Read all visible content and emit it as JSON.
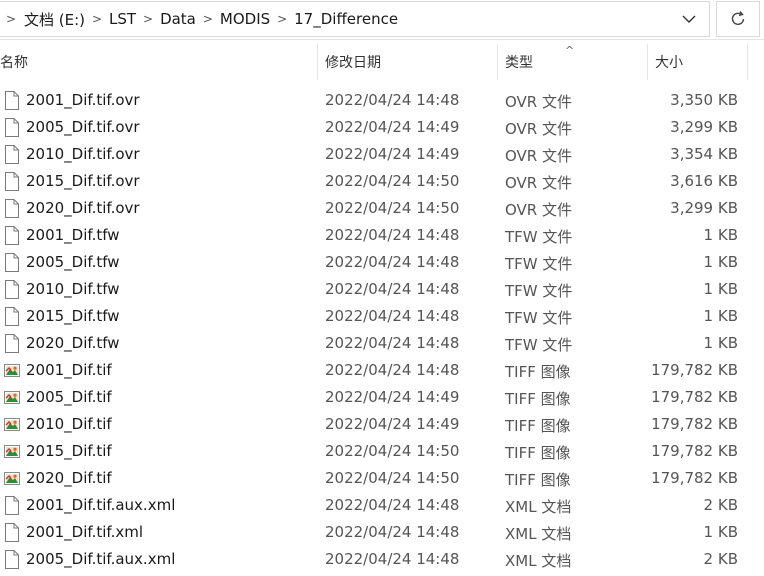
{
  "breadcrumb": [
    "文档 (E:)",
    "LST",
    "Data",
    "MODIS",
    "17_Difference"
  ],
  "icons": {
    "dropdown": "chevron-down-icon",
    "refresh": "refresh-icon",
    "generic_file": "file-icon",
    "tiff_file": "image-file-icon"
  },
  "columns": {
    "name": "名称",
    "date": "修改日期",
    "type": "类型",
    "size": "大小"
  },
  "files": [
    {
      "name": "2001_Dif.tif.ovr",
      "date": "2022/04/24 14:48",
      "type": "OVR 文件",
      "size": "3,350 KB",
      "icon": "file"
    },
    {
      "name": "2005_Dif.tif.ovr",
      "date": "2022/04/24 14:49",
      "type": "OVR 文件",
      "size": "3,299 KB",
      "icon": "file"
    },
    {
      "name": "2010_Dif.tif.ovr",
      "date": "2022/04/24 14:49",
      "type": "OVR 文件",
      "size": "3,354 KB",
      "icon": "file"
    },
    {
      "name": "2015_Dif.tif.ovr",
      "date": "2022/04/24 14:50",
      "type": "OVR 文件",
      "size": "3,616 KB",
      "icon": "file"
    },
    {
      "name": "2020_Dif.tif.ovr",
      "date": "2022/04/24 14:50",
      "type": "OVR 文件",
      "size": "3,299 KB",
      "icon": "file"
    },
    {
      "name": "2001_Dif.tfw",
      "date": "2022/04/24 14:48",
      "type": "TFW 文件",
      "size": "1 KB",
      "icon": "file"
    },
    {
      "name": "2005_Dif.tfw",
      "date": "2022/04/24 14:48",
      "type": "TFW 文件",
      "size": "1 KB",
      "icon": "file"
    },
    {
      "name": "2010_Dif.tfw",
      "date": "2022/04/24 14:48",
      "type": "TFW 文件",
      "size": "1 KB",
      "icon": "file"
    },
    {
      "name": "2015_Dif.tfw",
      "date": "2022/04/24 14:48",
      "type": "TFW 文件",
      "size": "1 KB",
      "icon": "file"
    },
    {
      "name": "2020_Dif.tfw",
      "date": "2022/04/24 14:48",
      "type": "TFW 文件",
      "size": "1 KB",
      "icon": "file"
    },
    {
      "name": "2001_Dif.tif",
      "date": "2022/04/24 14:48",
      "type": "TIFF 图像",
      "size": "179,782 KB",
      "icon": "tiff"
    },
    {
      "name": "2005_Dif.tif",
      "date": "2022/04/24 14:49",
      "type": "TIFF 图像",
      "size": "179,782 KB",
      "icon": "tiff"
    },
    {
      "name": "2010_Dif.tif",
      "date": "2022/04/24 14:49",
      "type": "TIFF 图像",
      "size": "179,782 KB",
      "icon": "tiff"
    },
    {
      "name": "2015_Dif.tif",
      "date": "2022/04/24 14:50",
      "type": "TIFF 图像",
      "size": "179,782 KB",
      "icon": "tiff"
    },
    {
      "name": "2020_Dif.tif",
      "date": "2022/04/24 14:50",
      "type": "TIFF 图像",
      "size": "179,782 KB",
      "icon": "tiff"
    },
    {
      "name": "2001_Dif.tif.aux.xml",
      "date": "2022/04/24 14:48",
      "type": "XML 文档",
      "size": "2 KB",
      "icon": "file"
    },
    {
      "name": "2001_Dif.tif.xml",
      "date": "2022/04/24 14:48",
      "type": "XML 文档",
      "size": "1 KB",
      "icon": "file"
    },
    {
      "name": "2005_Dif.tif.aux.xml",
      "date": "2022/04/24 14:48",
      "type": "XML 文档",
      "size": "2 KB",
      "icon": "file"
    }
  ]
}
